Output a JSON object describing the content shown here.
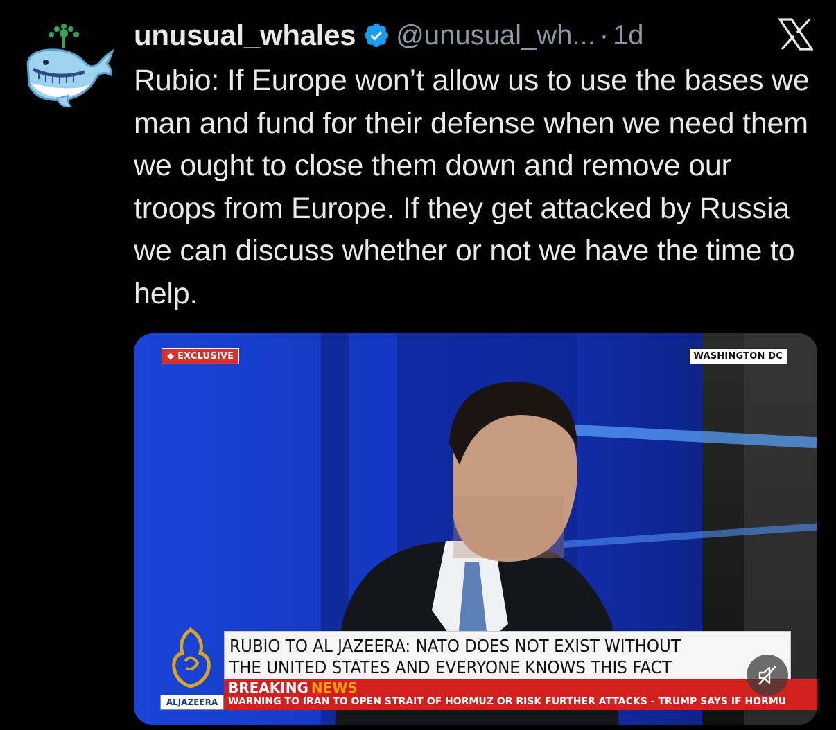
{
  "tweet": {
    "author_name": "unusual_whales",
    "handle": "@unusual_wh...",
    "separator": "·",
    "time": "1d",
    "text": "Rubio: If Europe won’t allow us to use the bases we man and fund for their defense when we need them we ought to close them down and remove our troops from Europe. If they get attacked by Russia we can discuss whether or not we have the time to help."
  },
  "video": {
    "exclusive_tag": "EXCLUSIVE",
    "location_tag": "WASHINGTON DC",
    "headline_line1": "RUBIO TO AL JAZEERA: NATO DOES NOT EXIST WITHOUT",
    "headline_line2": "THE UNITED STATES AND EVERYONE KNOWS THIS FACT",
    "breaking_label": "BREAKING",
    "news_label": "NEWS",
    "ticker_text": "WARNING TO IRAN TO OPEN STRAIT OF HORMUZ OR RISK FURTHER ATTACKS  -  TRUMP SAYS IF HORMU",
    "brand_label": "ALJAZEERA"
  },
  "icons": {
    "avatar": "whale-avatar-icon",
    "verified": "verified-badge-icon",
    "platform": "x-logo-icon",
    "mute": "muted-speaker-icon"
  },
  "colors": {
    "background": "#000000",
    "text": "#e7e9ea",
    "secondary_text": "#8b98a5",
    "verified_blue": "#1d9bf0",
    "studio_blue": "#1535c0",
    "breaking_red": "#d41f1f"
  }
}
